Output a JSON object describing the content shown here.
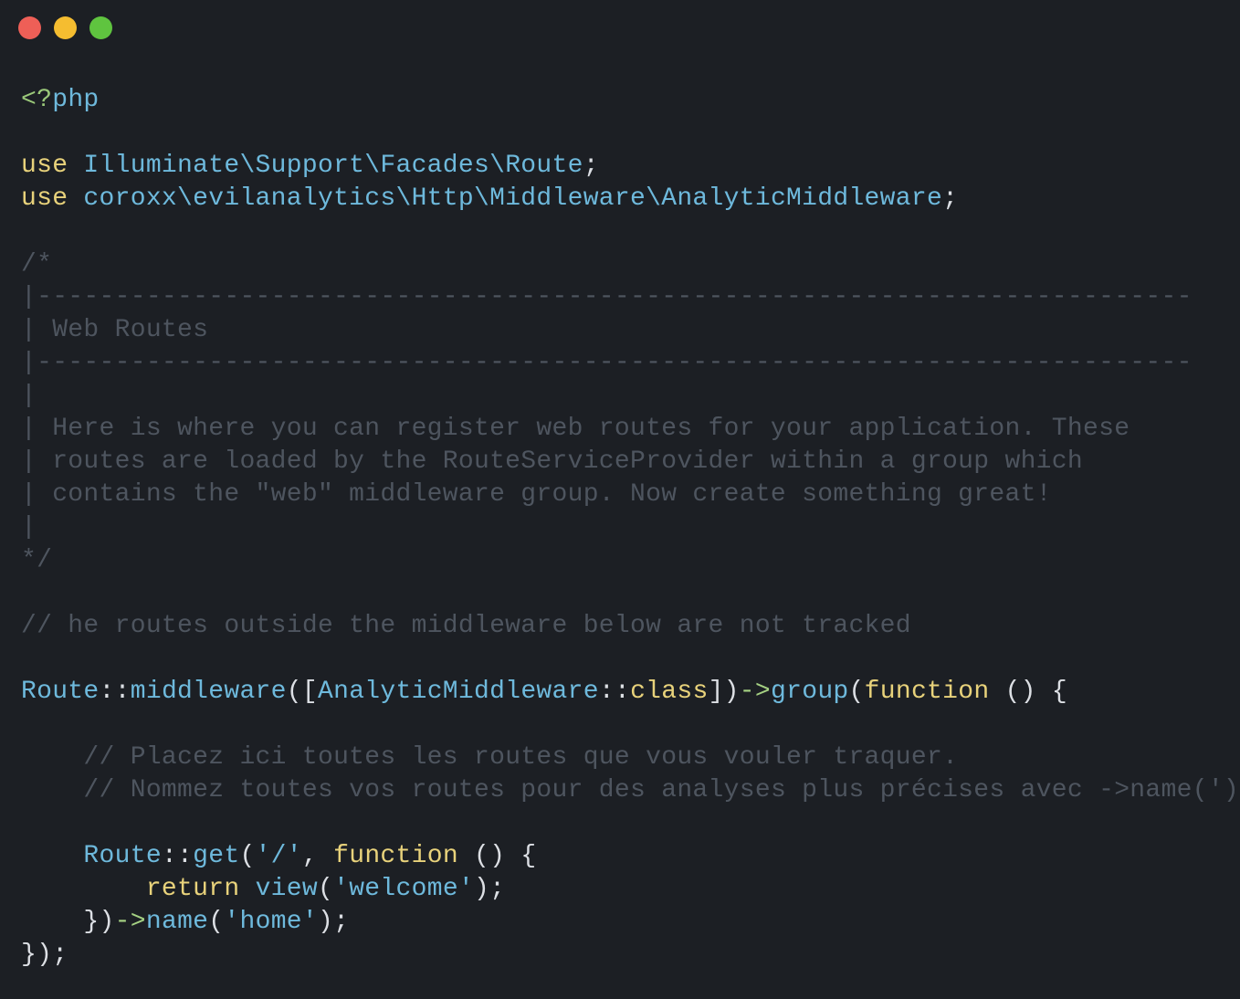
{
  "window": {
    "controls": [
      {
        "name": "close",
        "color": "#ee5f57"
      },
      {
        "name": "minimize",
        "color": "#f5bd30"
      },
      {
        "name": "maximize",
        "color": "#5fc43f"
      }
    ]
  },
  "colors": {
    "background": "#1c1f24",
    "plain": "#dcdfe4",
    "keyword": "#e8d27b",
    "namespace": "#6eb9dc",
    "comment": "#4e555f",
    "operator": "#a5d183"
  },
  "code": {
    "lines": [
      [
        {
          "t": "tag",
          "v": "<?"
        },
        {
          "t": "php",
          "v": "php"
        }
      ],
      [],
      [
        {
          "t": "kw",
          "v": "use"
        },
        {
          "t": "plain",
          "v": " "
        },
        {
          "t": "ns",
          "v": "Illuminate\\Support\\Facades\\Route"
        },
        {
          "t": "punc",
          "v": ";"
        }
      ],
      [
        {
          "t": "kw",
          "v": "use"
        },
        {
          "t": "plain",
          "v": " "
        },
        {
          "t": "ns",
          "v": "coroxx\\evilanalytics\\Http\\Middleware\\AnalyticMiddleware"
        },
        {
          "t": "punc",
          "v": ";"
        }
      ],
      [],
      [
        {
          "t": "comment",
          "v": "/*"
        }
      ],
      [
        {
          "t": "comment",
          "v": "|--------------------------------------------------------------------------"
        }
      ],
      [
        {
          "t": "comment",
          "v": "| Web Routes"
        }
      ],
      [
        {
          "t": "comment",
          "v": "|--------------------------------------------------------------------------"
        }
      ],
      [
        {
          "t": "comment",
          "v": "|"
        }
      ],
      [
        {
          "t": "comment",
          "v": "| Here is where you can register web routes for your application. These"
        }
      ],
      [
        {
          "t": "comment",
          "v": "| routes are loaded by the RouteServiceProvider within a group which"
        }
      ],
      [
        {
          "t": "comment",
          "v": "| contains the \"web\" middleware group. Now create something great!"
        }
      ],
      [
        {
          "t": "comment",
          "v": "|"
        }
      ],
      [
        {
          "t": "comment",
          "v": "*/"
        }
      ],
      [],
      [
        {
          "t": "comment",
          "v": "// he routes outside the middleware below are not tracked"
        }
      ],
      [],
      [
        {
          "t": "cls",
          "v": "Route"
        },
        {
          "t": "punc",
          "v": "::"
        },
        {
          "t": "fn",
          "v": "middleware"
        },
        {
          "t": "punc",
          "v": "(["
        },
        {
          "t": "cls",
          "v": "AnalyticMiddleware"
        },
        {
          "t": "punc",
          "v": "::"
        },
        {
          "t": "kw",
          "v": "class"
        },
        {
          "t": "punc",
          "v": "])"
        },
        {
          "t": "op",
          "v": "->"
        },
        {
          "t": "fn",
          "v": "group"
        },
        {
          "t": "punc",
          "v": "("
        },
        {
          "t": "kw",
          "v": "function"
        },
        {
          "t": "punc",
          "v": " () {"
        }
      ],
      [],
      [
        {
          "t": "plain",
          "v": "    "
        },
        {
          "t": "comment",
          "v": "// Placez ici toutes les routes que vous vouler traquer."
        }
      ],
      [
        {
          "t": "plain",
          "v": "    "
        },
        {
          "t": "comment",
          "v": "// Nommez toutes vos routes pour des analyses plus précises avec ->name(')"
        }
      ],
      [],
      [
        {
          "t": "plain",
          "v": "    "
        },
        {
          "t": "cls",
          "v": "Route"
        },
        {
          "t": "punc",
          "v": "::"
        },
        {
          "t": "fn",
          "v": "get"
        },
        {
          "t": "punc",
          "v": "("
        },
        {
          "t": "str",
          "v": "'/'"
        },
        {
          "t": "punc",
          "v": ", "
        },
        {
          "t": "kw",
          "v": "function"
        },
        {
          "t": "punc",
          "v": " () {"
        }
      ],
      [
        {
          "t": "plain",
          "v": "        "
        },
        {
          "t": "kw",
          "v": "return"
        },
        {
          "t": "plain",
          "v": " "
        },
        {
          "t": "fn",
          "v": "view"
        },
        {
          "t": "punc",
          "v": "("
        },
        {
          "t": "str",
          "v": "'welcome'"
        },
        {
          "t": "punc",
          "v": ");"
        }
      ],
      [
        {
          "t": "plain",
          "v": "    "
        },
        {
          "t": "punc",
          "v": "})"
        },
        {
          "t": "op",
          "v": "->"
        },
        {
          "t": "fn",
          "v": "name"
        },
        {
          "t": "punc",
          "v": "("
        },
        {
          "t": "str",
          "v": "'home'"
        },
        {
          "t": "punc",
          "v": ");"
        }
      ],
      [
        {
          "t": "punc",
          "v": "});"
        }
      ]
    ]
  }
}
